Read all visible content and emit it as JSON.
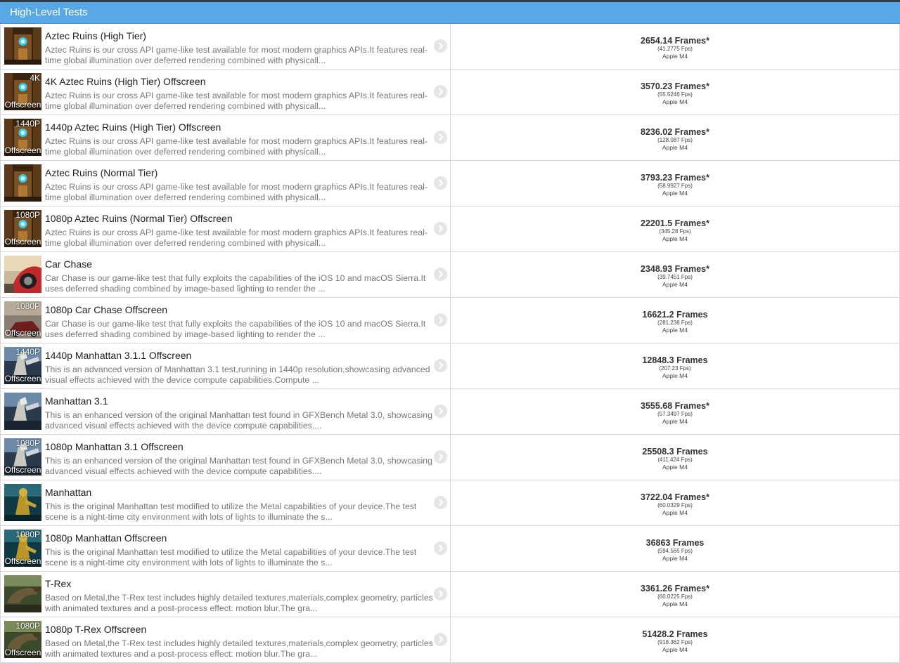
{
  "header": {
    "title": "High-Level Tests"
  },
  "colors": {
    "header": "#58a8e6",
    "text_muted": "#777777"
  },
  "tests": [
    {
      "title": "Aztec Ruins (High Tier)",
      "description": "Aztec Ruins is our cross API game-like test available for most modern graphics APIs.It features real-time global illumination over deferred rendering combined with physicall...",
      "frames": "2654.14 Frames*",
      "fps": "(41.2775 Fps)",
      "device": "Apple M4",
      "thumb": "aztec",
      "tag_top": "",
      "tag_bottom": ""
    },
    {
      "title": "4K Aztec Ruins (High Tier) Offscreen",
      "description": "Aztec Ruins is our cross API game-like test available for most modern graphics APIs.It features real-time global illumination over deferred rendering combined with physicall...",
      "frames": "3570.23 Frames*",
      "fps": "(55.5246 Fps)",
      "device": "Apple M4",
      "thumb": "aztec",
      "tag_top": "4K",
      "tag_bottom": "Offscreen"
    },
    {
      "title": "1440p Aztec Ruins (High Tier) Offscreen",
      "description": "Aztec Ruins is our cross API game-like test available for most modern graphics APIs.It features real-time global illumination over deferred rendering combined with physicall...",
      "frames": "8236.02 Frames*",
      "fps": "(128.087 Fps)",
      "device": "Apple M4",
      "thumb": "aztec",
      "tag_top": "1440P",
      "tag_bottom": "Offscreen"
    },
    {
      "title": "Aztec Ruins (Normal Tier)",
      "description": "Aztec Ruins is our cross API game-like test available for most modern graphics APIs.It features real-time global illumination over deferred rendering combined with physicall...",
      "frames": "3793.23 Frames*",
      "fps": "(58.9927 Fps)",
      "device": "Apple M4",
      "thumb": "aztec",
      "tag_top": "",
      "tag_bottom": ""
    },
    {
      "title": "1080p Aztec Ruins (Normal Tier) Offscreen",
      "description": "Aztec Ruins is our cross API game-like test available for most modern graphics APIs.It features real-time global illumination over deferred rendering combined with physicall...",
      "frames": "22201.5 Frames*",
      "fps": "(345.28 Fps)",
      "device": "Apple M4",
      "thumb": "aztec",
      "tag_top": "1080P",
      "tag_bottom": "Offscreen"
    },
    {
      "title": "Car Chase",
      "description": "Car Chase is our game-like test that fully exploits the capabilities of the iOS 10 and macOS Sierra.It uses deferred shading combined by image-based lighting to render the ...",
      "frames": "2348.93 Frames*",
      "fps": "(39.7451 Fps)",
      "device": "Apple M4",
      "thumb": "car",
      "tag_top": "",
      "tag_bottom": ""
    },
    {
      "title": "1080p Car Chase Offscreen",
      "description": "Car Chase is our game-like test that fully exploits the capabilities of the iOS 10 and macOS Sierra.It uses deferred shading combined by image-based lighting to render the ...",
      "frames": "16621.2 Frames",
      "fps": "(281.238 Fps)",
      "device": "Apple M4",
      "thumb": "car2",
      "tag_top": "1080P",
      "tag_bottom": "Offscreen"
    },
    {
      "title": "1440p Manhattan 3.1.1 Offscreen",
      "description": "This is an advanced version of Manhattan 3.1 test,running in 1440p resolution,showcasing advanced visual effects achieved with the device compute capabilities.Compute ...",
      "frames": "12848.3 Frames",
      "fps": "(207.23 Fps)",
      "device": "Apple M4",
      "thumb": "manhattan31",
      "tag_top": "1440P",
      "tag_bottom": "Offscreen"
    },
    {
      "title": "Manhattan 3.1",
      "description": "This is an enhanced version of the original Manhattan test found in GFXBench Metal 3.0, showcasing advanced visual effects achieved with the device compute capabilities....",
      "frames": "3555.68 Frames*",
      "fps": "(57.3497 Fps)",
      "device": "Apple M4",
      "thumb": "manhattan31",
      "tag_top": "",
      "tag_bottom": ""
    },
    {
      "title": "1080p Manhattan 3.1 Offscreen",
      "description": "This is an enhanced version of the original Manhattan test found in GFXBench Metal 3.0, showcasing advanced visual effects achieved with the device compute capabilities....",
      "frames": "25508.3 Frames",
      "fps": "(411.424 Fps)",
      "device": "Apple M4",
      "thumb": "manhattan31",
      "tag_top": "1080P",
      "tag_bottom": "Offscreen"
    },
    {
      "title": "Manhattan",
      "description": "This is the original Manhattan test modified to utilize the Metal capabilities of your device.The test scene is a night-time city environment with lots of lights to illuminate the s...",
      "frames": "3722.04 Frames*",
      "fps": "(60.0329 Fps)",
      "device": "Apple M4",
      "thumb": "manhattan",
      "tag_top": "",
      "tag_bottom": ""
    },
    {
      "title": "1080p Manhattan Offscreen",
      "description": "This is the original Manhattan test modified to utilize the Metal capabilities of your device.The test scene is a night-time city environment with lots of lights to illuminate the s...",
      "frames": "36863 Frames",
      "fps": "(594.565 Fps)",
      "device": "Apple M4",
      "thumb": "manhattan",
      "tag_top": "1080P",
      "tag_bottom": "Offscreen"
    },
    {
      "title": "T-Rex",
      "description": "Based on Metal,the T-Rex test includes highly detailed textures,materials,complex geometry, particles with animated textures and a post-process effect: motion blur.The gra...",
      "frames": "3361.26 Frames*",
      "fps": "(60.0225 Fps)",
      "device": "Apple M4",
      "thumb": "trex",
      "tag_top": "",
      "tag_bottom": ""
    },
    {
      "title": "1080p T-Rex Offscreen",
      "description": "Based on Metal,the T-Rex test includes highly detailed textures,materials,complex geometry, particles with animated textures and a post-process effect: motion blur.The gra...",
      "frames": "51428.2 Frames",
      "fps": "(918.362 Fps)",
      "device": "Apple M4",
      "thumb": "trex",
      "tag_top": "1080P",
      "tag_bottom": "Offscreen"
    }
  ]
}
